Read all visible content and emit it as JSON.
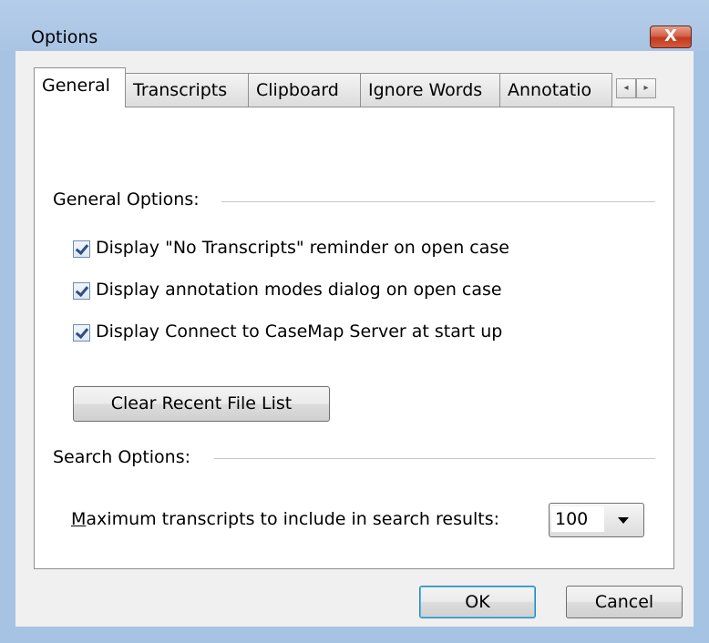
{
  "window": {
    "title": "Options",
    "close_label": "X"
  },
  "tabs": [
    {
      "label": "General"
    },
    {
      "label": "Transcripts"
    },
    {
      "label": "Clipboard"
    },
    {
      "label": "Ignore Words"
    },
    {
      "label": "Annotatio"
    }
  ],
  "tab_scroll": {
    "left": "◂",
    "right": "▸"
  },
  "general": {
    "group_label": "General Options:",
    "checkboxes": [
      {
        "label": "Display \"No Transcripts\" reminder on open case",
        "checked": true
      },
      {
        "label": "Display annotation modes dialog on open case",
        "checked": true
      },
      {
        "label": "Display Connect to CaseMap Server at start up",
        "checked": true
      }
    ],
    "clear_button": "Clear Recent File List"
  },
  "search": {
    "group_label": "Search Options:",
    "max_label_accel": "M",
    "max_label_rest": "aximum transcripts to include in search results:",
    "max_value": "100"
  },
  "footer": {
    "ok": "OK",
    "cancel": "Cancel"
  }
}
